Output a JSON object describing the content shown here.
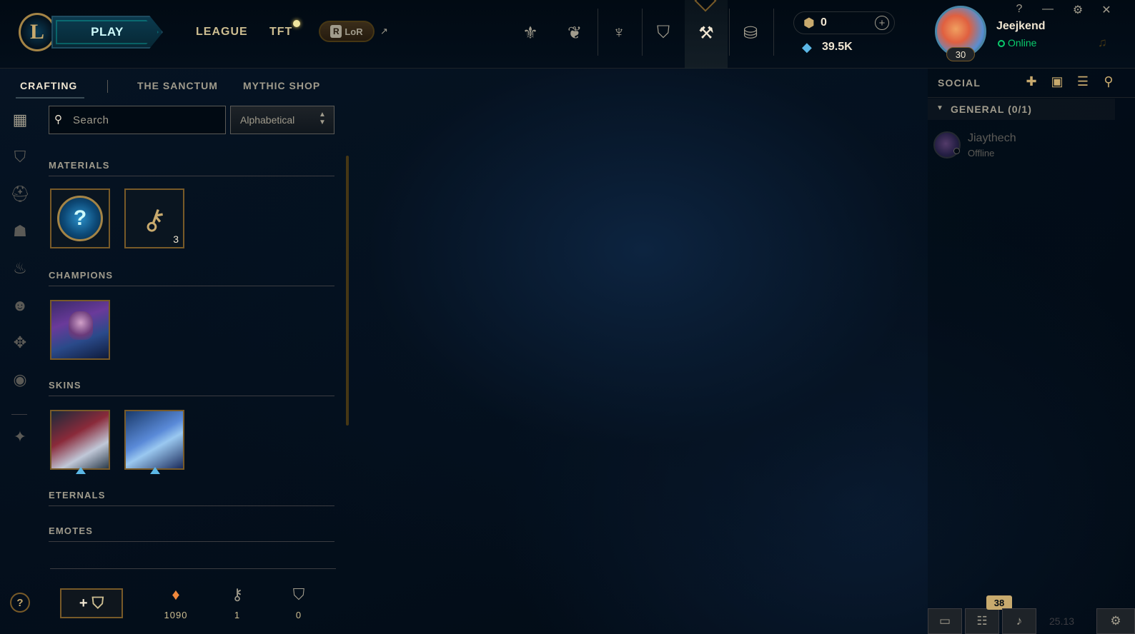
{
  "topbar": {
    "logo_letter": "L",
    "play_label": "PLAY",
    "nav": [
      {
        "label": "LEAGUE"
      },
      {
        "label": "TFT"
      }
    ],
    "lor_label": "LoR",
    "lor_badge": "R",
    "external_icon": "↗",
    "icons": [
      {
        "name": "home-icon",
        "glyph": "⚜"
      },
      {
        "name": "tft-icon",
        "glyph": "❦"
      },
      {
        "name": "clash-icon",
        "glyph": "♆"
      },
      {
        "name": "collection-icon",
        "glyph": "⛉"
      },
      {
        "name": "loot-icon",
        "glyph": "⚒"
      },
      {
        "name": "store-icon",
        "glyph": "⛁"
      }
    ],
    "rp_value": "0",
    "be_value": "39.5K",
    "plus_glyph": "+",
    "username": "Jeejkend",
    "status": "Online",
    "level": "30",
    "window_controls": [
      "?",
      "—",
      "⚙",
      "✕"
    ],
    "bell_glyph": "🔔"
  },
  "subnav": {
    "items": [
      "CRAFTING",
      "THE SANCTUM",
      "MYTHIC SHOP"
    ],
    "active": "CRAFTING"
  },
  "sidebar_icons": [
    {
      "name": "all-loot-icon",
      "glyph": "▦",
      "active": true
    },
    {
      "name": "chest-icon",
      "glyph": "⛉"
    },
    {
      "name": "champion-icon",
      "glyph": "⛑"
    },
    {
      "name": "skin-icon",
      "glyph": "☗"
    },
    {
      "name": "ward-icon",
      "glyph": "♨"
    },
    {
      "name": "emote-icon",
      "glyph": "☻"
    },
    {
      "name": "eternals-icon",
      "glyph": "✥"
    },
    {
      "name": "icons-icon",
      "glyph": "◉"
    },
    {
      "name": "special-icon",
      "glyph": "✦"
    }
  ],
  "search": {
    "placeholder": "Search",
    "icon": "🔍"
  },
  "sort": {
    "selected": "Alphabetical",
    "arrows": "▲▼"
  },
  "sections": {
    "materials": "MATERIALS",
    "champions": "CHAMPIONS",
    "skins": "SKINS",
    "eternals": "ETERNALS",
    "emotes": "EMOTES"
  },
  "materials": [
    {
      "name": "mystery-orb",
      "glyph": "?",
      "count": ""
    },
    {
      "name": "hextech-key",
      "glyph": "🗝",
      "count": "3"
    }
  ],
  "bottom": {
    "help_glyph": "?",
    "add_chest_glyph": "+",
    "add_chest_icon": "⛉",
    "stats": [
      {
        "name": "orange-essence",
        "glyph": "♦",
        "value": "1090",
        "color": "#f0883c"
      },
      {
        "name": "key-fragment",
        "glyph": "⚷",
        "value": "1",
        "color": "#a09b8c"
      },
      {
        "name": "chest",
        "glyph": "⛉",
        "value": "0",
        "color": "#a09b8c"
      }
    ]
  },
  "social": {
    "title": "SOCIAL",
    "icons": [
      {
        "name": "add-friend-icon",
        "glyph": "👤"
      },
      {
        "name": "add-folder-icon",
        "glyph": "📁"
      },
      {
        "name": "list-icon",
        "glyph": "☰"
      },
      {
        "name": "search-friend-icon",
        "glyph": "🔍"
      }
    ],
    "group": "GENERAL (0/1)",
    "group_caret": "▼",
    "friend_name": "Jiaythech",
    "friend_status": "Offline"
  },
  "bottom_bar": {
    "chat_glyph": "💬",
    "missions_glyph": "☷",
    "mic_glyph": "🎙",
    "notification_count": "38",
    "version": "25.13",
    "settings_glyph": "⚙"
  },
  "colors": {
    "gold": "#c8aa6e",
    "accent_teal": "#0ac8b9",
    "online_green": "#0acb6c",
    "blue_essence": "#5bb7e6",
    "orange_essence": "#f0883c"
  }
}
